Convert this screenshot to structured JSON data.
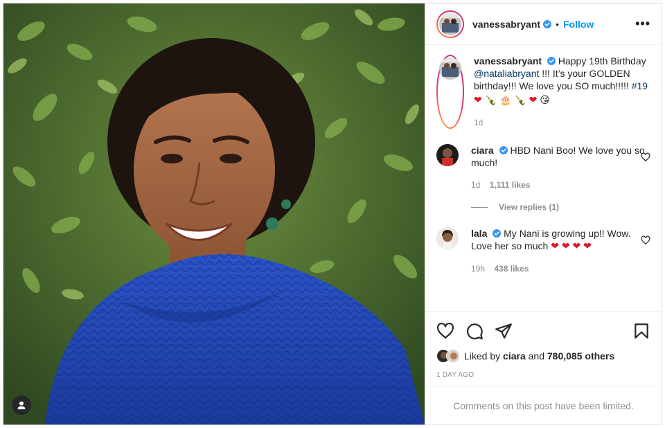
{
  "post": {
    "author": "vanessabryant",
    "follow_label": "Follow",
    "dot": "•",
    "more_label": "•••"
  },
  "caption": {
    "username": "vanessabryant",
    "text_1": "Happy 19th Birthday",
    "mention": "@nataliabryant",
    "text_2": "!!! It’s your GOLDEN birthday!!! We love you SO much!!!!!",
    "hashtag": "#19",
    "emojis": [
      "❤",
      "🍾",
      "🎂",
      "🍾",
      "❤",
      "😘"
    ],
    "time": "1d"
  },
  "comments": [
    {
      "username": "ciara",
      "text": "HBD Nani Boo! We love you so much!",
      "time": "1d",
      "likes": "1,111 likes",
      "view_replies": "View replies (1)"
    },
    {
      "username": "lala",
      "text": "My Nani is growing up!! Wow. Love her so much",
      "emojis": [
        "❤",
        "❤",
        "❤",
        "❤"
      ],
      "time": "19h",
      "likes": "438 likes"
    }
  ],
  "likes": {
    "prefix": "Liked by",
    "user": "ciara",
    "joiner": "and",
    "others": "780,085 others"
  },
  "timestamp": "1 DAY AGO",
  "comments_limited": "Comments on this post have been limited.",
  "icons": {
    "like": "heart-icon",
    "comment": "comment-icon",
    "share": "send-icon",
    "save": "bookmark-icon",
    "verified": "verified-badge-icon",
    "user_tag": "user-tag-icon"
  },
  "colors": {
    "accent": "#0095f6",
    "text": "#262626",
    "muted": "#8e8e8e",
    "heart": "#e0162b",
    "sweater": "#2348b8"
  }
}
